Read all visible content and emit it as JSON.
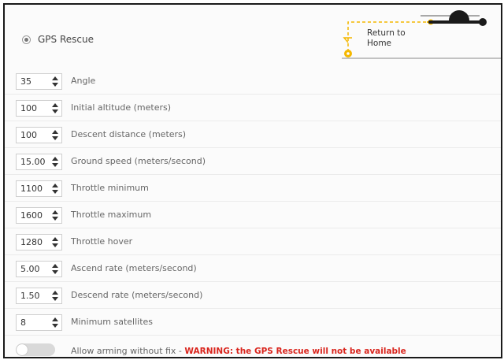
{
  "section": {
    "radio_label": "GPS Rescue",
    "rth_label_line1": "Return to",
    "rth_label_line2": "Home"
  },
  "settings": [
    {
      "value": "35",
      "label": "Angle"
    },
    {
      "value": "100",
      "label": "Initial altitude (meters)"
    },
    {
      "value": "100",
      "label": "Descent distance (meters)"
    },
    {
      "value": "15.00",
      "label": "Ground speed (meters/second)"
    },
    {
      "value": "1100",
      "label": "Throttle minimum"
    },
    {
      "value": "1600",
      "label": "Throttle maximum"
    },
    {
      "value": "1280",
      "label": "Throttle hover"
    },
    {
      "value": "5.00",
      "label": "Ascend rate (meters/second)"
    },
    {
      "value": "1.50",
      "label": "Descend rate (meters/second)"
    },
    {
      "value": "8",
      "label": "Minimum satellites"
    }
  ],
  "arming": {
    "label": "Allow arming without fix - ",
    "warning": "WARNING: the GPS Rescue will not be available",
    "enabled": false
  },
  "colors": {
    "accent": "#f5b800",
    "warning": "#d9241c",
    "toggle_off": "#d9d9d9"
  },
  "icons": {
    "radio": "radio-button-icon",
    "spinner": "spinner-arrows-icon",
    "rth": "return-to-home-icon"
  }
}
